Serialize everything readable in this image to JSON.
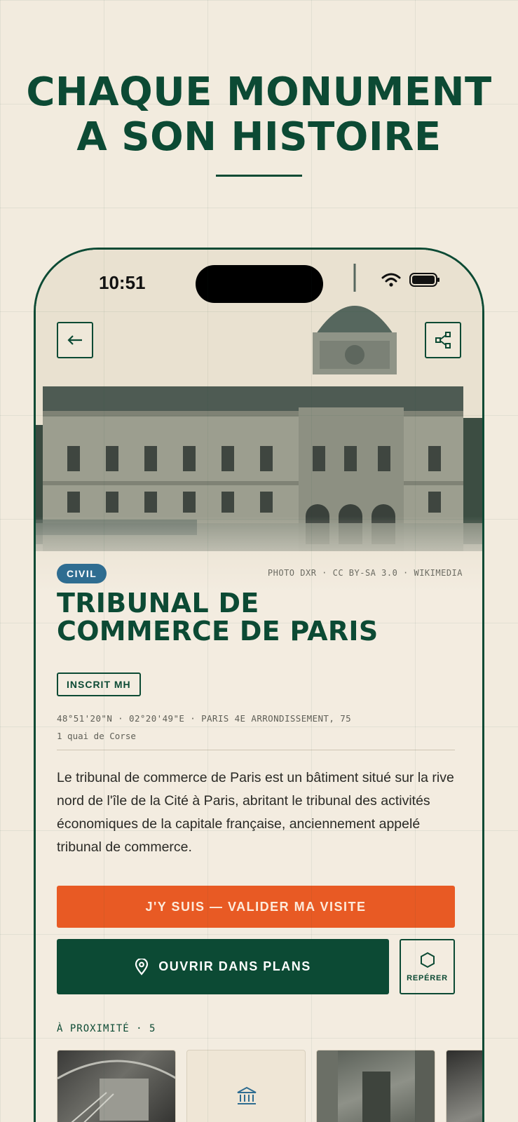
{
  "headline": {
    "line1": "CHAQUE MONUMENT",
    "line2": "A SON HISTOIRE"
  },
  "status_bar": {
    "time": "10:51"
  },
  "icons": {
    "back": "arrow-left-icon",
    "share": "share-icon",
    "pin": "map-pin-icon",
    "locate": "hexagon-icon",
    "museum": "museum-icon"
  },
  "monument": {
    "category": "CIVIL",
    "photo_credit": "PHOTO DXR · CC BY-SA 3.0 · WIKIMEDIA",
    "title": "TRIBUNAL DE\nCOMMERCE DE PARIS",
    "tag": "INSCRIT MH",
    "coordinates": "48°51'20\"N · 02°20'49\"E · PARIS 4E ARRONDISSEMENT, 75",
    "address": "1 quai de Corse",
    "description": "Le tribunal de commerce de Paris est un bâtiment situé sur la rive nord de l'île de la Cité à Paris, abritant le tribunal des activités économiques de la capitale française, anciennement appelé tribunal de commerce."
  },
  "actions": {
    "visit_label": "J'Y SUIS — VALIDER MA VISITE",
    "maps_label": "OUVRIR DANS PLANS",
    "locate_label": "REPÉRER"
  },
  "nearby": {
    "label": "À PROXIMITÉ · 5"
  },
  "colors": {
    "brand_green": "#0c4a34",
    "accent_orange": "#e85a24",
    "civil_blue": "#2f6d91",
    "background": "#f2ebde"
  }
}
